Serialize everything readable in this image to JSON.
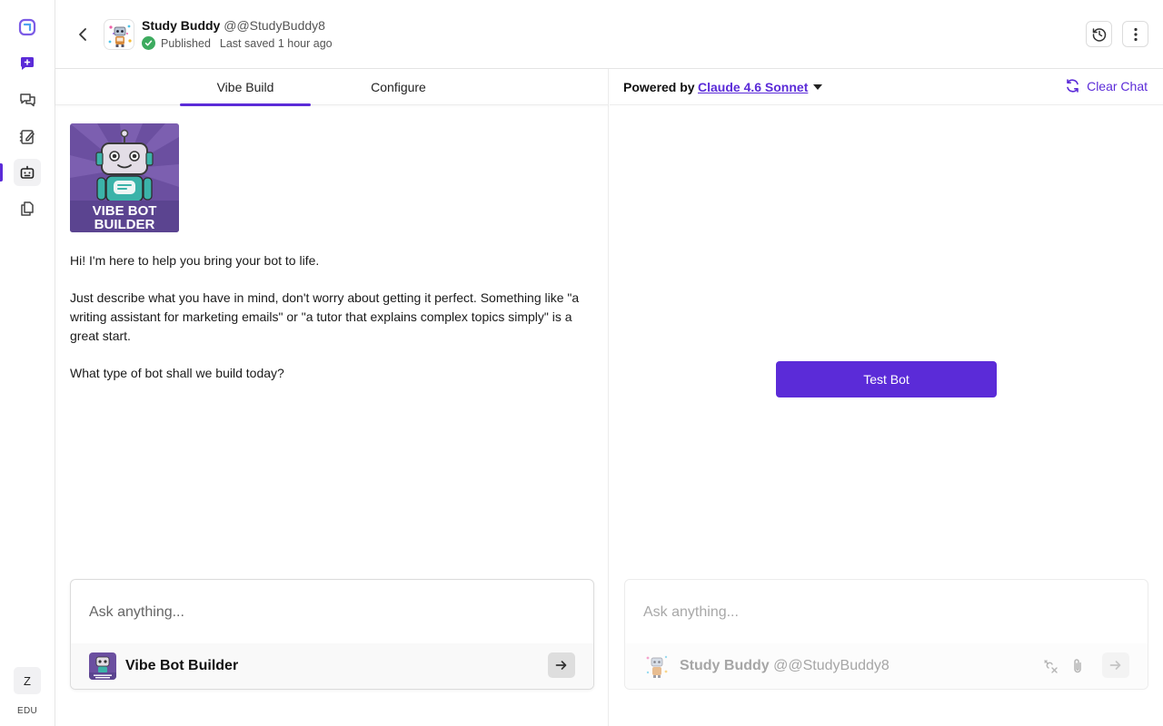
{
  "header": {
    "bot_name": "Study Buddy",
    "bot_handle": "@@StudyBuddy8",
    "status": "Published",
    "last_saved": "Last saved 1 hour ago"
  },
  "rail": {
    "items": [
      {
        "icon": "app-logo-icon"
      },
      {
        "icon": "new-chat-icon"
      },
      {
        "icon": "chats-icon"
      },
      {
        "icon": "notebook-icon"
      },
      {
        "icon": "bots-icon",
        "active": true
      },
      {
        "icon": "documents-icon"
      }
    ],
    "user_initial": "Z",
    "plan_label": "EDU"
  },
  "left": {
    "tabs": [
      {
        "label": "Vibe Build",
        "active": true
      },
      {
        "label": "Configure",
        "active": false
      }
    ],
    "builder_image": {
      "line1": "VIBE BOT",
      "line2": "BUILDER"
    },
    "messages": [
      "Hi! I'm here to help you bring your bot to life.",
      "Just describe what you have in mind, don't worry about getting it perfect. Something like \"a writing assistant for marketing emails\" or \"a tutor that explains complex topics simply\" is a great start.",
      "What type of bot shall we build today?"
    ],
    "composer": {
      "placeholder": "Ask anything...",
      "bot_name": "Vibe Bot Builder"
    }
  },
  "right": {
    "powered_by_label": "Powered by",
    "model_name": "Claude 4.6 Sonnet",
    "clear_chat_label": "Clear Chat",
    "test_bot_label": "Test Bot",
    "composer": {
      "placeholder": "Ask anything...",
      "bot_name": "Study Buddy",
      "bot_handle": "@@StudyBuddy8"
    }
  },
  "colors": {
    "accent": "#5b2bd8",
    "status_green": "#3dab5f"
  }
}
